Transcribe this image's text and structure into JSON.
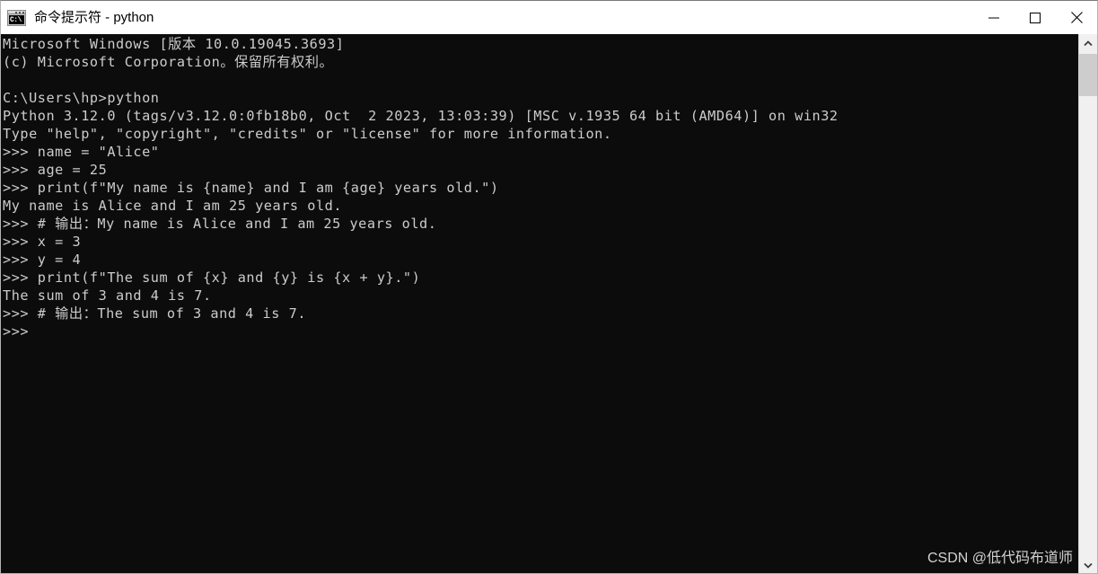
{
  "window": {
    "title": "命令提示符 - python",
    "icon": "cmd-icon",
    "icon_text": "C:\\",
    "background_color": "#0c0c0c",
    "titlebar_color": "#ffffff"
  },
  "window_controls": {
    "minimize": {
      "name": "minimize-icon",
      "label": "—"
    },
    "maximize": {
      "name": "maximize-icon",
      "label": "□"
    },
    "close": {
      "name": "close-icon",
      "label": "✕"
    }
  },
  "terminal": {
    "text_color": "#cccccc",
    "lines": [
      "Microsoft Windows [版本 10.0.19045.3693]",
      "(c) Microsoft Corporation。保留所有权利。",
      "",
      "C:\\Users\\hp>python",
      "Python 3.12.0 (tags/v3.12.0:0fb18b0, Oct  2 2023, 13:03:39) [MSC v.1935 64 bit (AMD64)] on win32",
      "Type \"help\", \"copyright\", \"credits\" or \"license\" for more information.",
      ">>> name = \"Alice\"",
      ">>> age = 25",
      ">>> print(f\"My name is {name} and I am {age} years old.\")",
      "My name is Alice and I am 25 years old.",
      ">>> # 输出：My name is Alice and I am 25 years old.",
      ">>> x = 3",
      ">>> y = 4",
      ">>> print(f\"The sum of {x} and {y} is {x + y}.\")",
      "The sum of 3 and 4 is 7.",
      ">>> # 输出：The sum of 3 and 4 is 7.",
      ">>> "
    ]
  },
  "scrollbar": {
    "up_arrow": "chevron-up-icon",
    "down_arrow": "chevron-down-icon",
    "thumb_color": "#cdcdcd",
    "track_color": "#f0f0f0"
  },
  "watermark": {
    "text": "CSDN @低代码布道师",
    "color": "#d2d2d2"
  }
}
